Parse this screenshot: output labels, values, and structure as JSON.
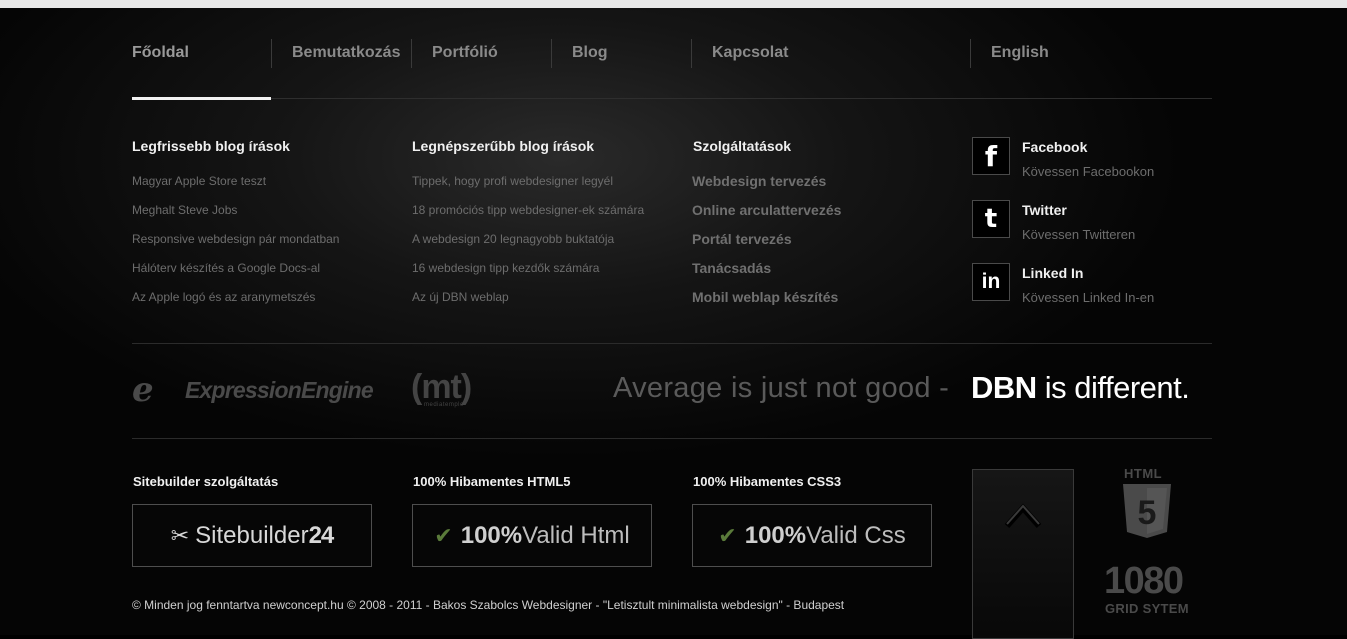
{
  "nav": {
    "items": [
      {
        "label": "Főoldal",
        "active": true
      },
      {
        "label": "Bemutatkozás"
      },
      {
        "label": "Portfólió"
      },
      {
        "label": "Blog"
      },
      {
        "label": "Kapcsolat"
      }
    ],
    "language": "English"
  },
  "latest_posts": {
    "title": "Legfrissebb blog írások",
    "items": [
      "Magyar Apple Store teszt",
      "Meghalt Steve Jobs",
      "Responsive webdesign pár mondatban",
      "Hálóterv készítés a Google Docs-al",
      "Az Apple logó és az aranymetszés"
    ]
  },
  "popular_posts": {
    "title": "Legnépszerűbb blog írások",
    "items": [
      "Tippek, hogy profi webdesigner legyél",
      "18 promóciós tipp webdesigner-ek számára",
      "A webdesign 20 legnagyobb buktatója",
      "16 webdesign tipp kezdők számára",
      "Az új DBN weblap"
    ]
  },
  "services": {
    "title": "Szolgáltatások",
    "items": [
      "Webdesign tervezés",
      "Online arculattervezés",
      "Portál tervezés",
      "Tanácsadás",
      "Mobil weblap készítés"
    ]
  },
  "social": [
    {
      "icon": "facebook-icon",
      "glyph": "f",
      "title": "Facebook",
      "subtitle": "Kövessen Facebookon"
    },
    {
      "icon": "twitter-icon",
      "glyph": "t",
      "title": "Twitter",
      "subtitle": "Kövessen Twitteren"
    },
    {
      "icon": "linkedin-icon",
      "glyph": "in",
      "title": "Linked In",
      "subtitle": "Kövessen Linked In-en"
    }
  ],
  "logos": {
    "ee_mark": "e",
    "ee_text": "ExpressionEngine",
    "mt_mark": "(mt)",
    "mt_small": "mediatemple"
  },
  "tagline": {
    "light": "Average is just not good  -",
    "brand": "DBN",
    "strong": " is different."
  },
  "badges": [
    {
      "title": "Sitebuilder szolgáltatás",
      "text_light": "Sitebuilder",
      "text_bold": "24",
      "icon": "scissors-icon"
    },
    {
      "title": "100% Hibamentes HTML5",
      "text_bold": "100%",
      "text_light": " Valid Html",
      "icon": "checkmark-icon"
    },
    {
      "title": "100% Hibamentes CSS3",
      "text_bold": "100%",
      "text_light": " Valid Css",
      "icon": "checkmark-icon"
    }
  ],
  "html5_logo": {
    "word": "HTML",
    "digit": "5"
  },
  "grid_logo": {
    "number": "1080",
    "label": "GRID SYTEM"
  },
  "copyright": "© Minden jog fenntartva newconcept.hu © 2008 - 2011 - Bakos Szabolcs Webdesigner - \"Letisztult minimalista webdesign\" - Budapest",
  "colors": {
    "background": "#000000",
    "text_primary": "#f0f0f0",
    "text_muted": "#6d6d6d",
    "check_green": "#5a7a3a"
  }
}
